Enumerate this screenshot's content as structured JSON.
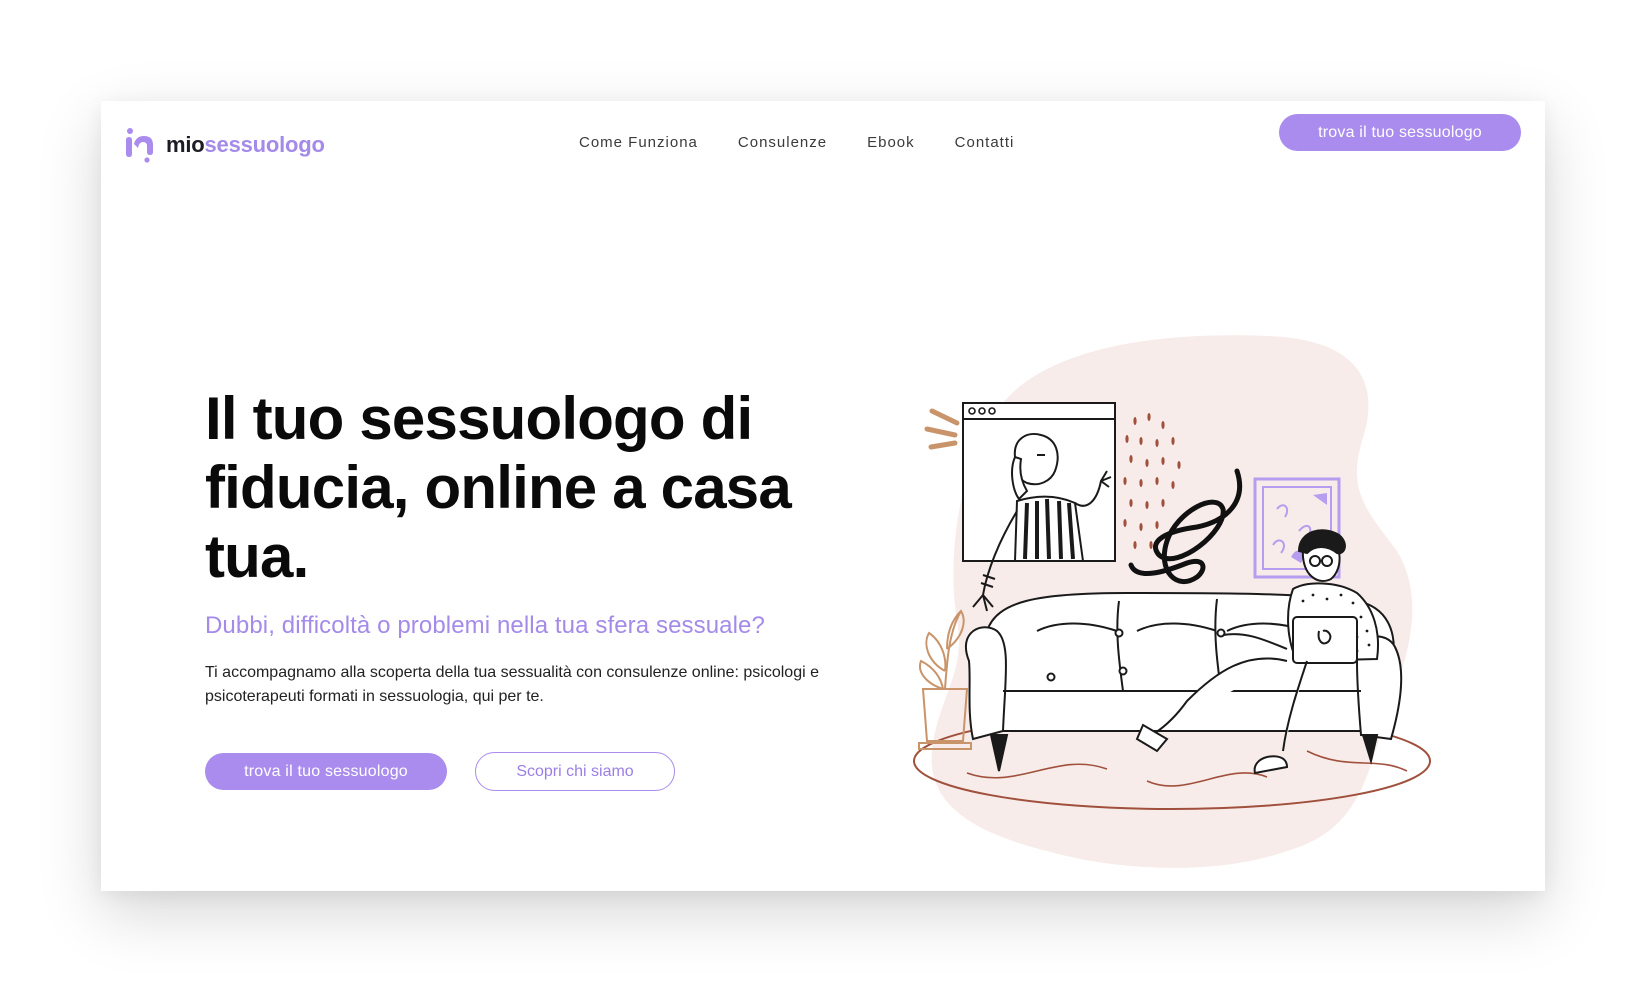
{
  "brand": {
    "name_part1": "mio",
    "name_part2": "sessuologo",
    "accent_color": "#a98cee",
    "dark_color": "#1c1c24"
  },
  "nav": {
    "items": [
      {
        "label": "Come Funziona"
      },
      {
        "label": "Consulenze"
      },
      {
        "label": "Ebook"
      },
      {
        "label": "Contatti"
      }
    ],
    "cta_label": "trova il tuo sessuologo"
  },
  "hero": {
    "title": "Il tuo sessuologo di fiducia, online a casa tua.",
    "subtitle": "Dubbi, difficoltà o problemi nella tua sfera sessuale?",
    "description": "Ti accompagnamo alla scoperta della tua sessualità con consulenze online: psicologi e psicoterapeuti formati in sessuologia, qui per te.",
    "primary_cta": "trova il tuo sessuologo",
    "secondary_cta": "Scopri chi siamo"
  },
  "illustration": {
    "icon": "video-call-couch-illustration",
    "blob_color": "#f7ece9",
    "rug_color": "#a0503c",
    "plant_color": "#c9946a"
  }
}
